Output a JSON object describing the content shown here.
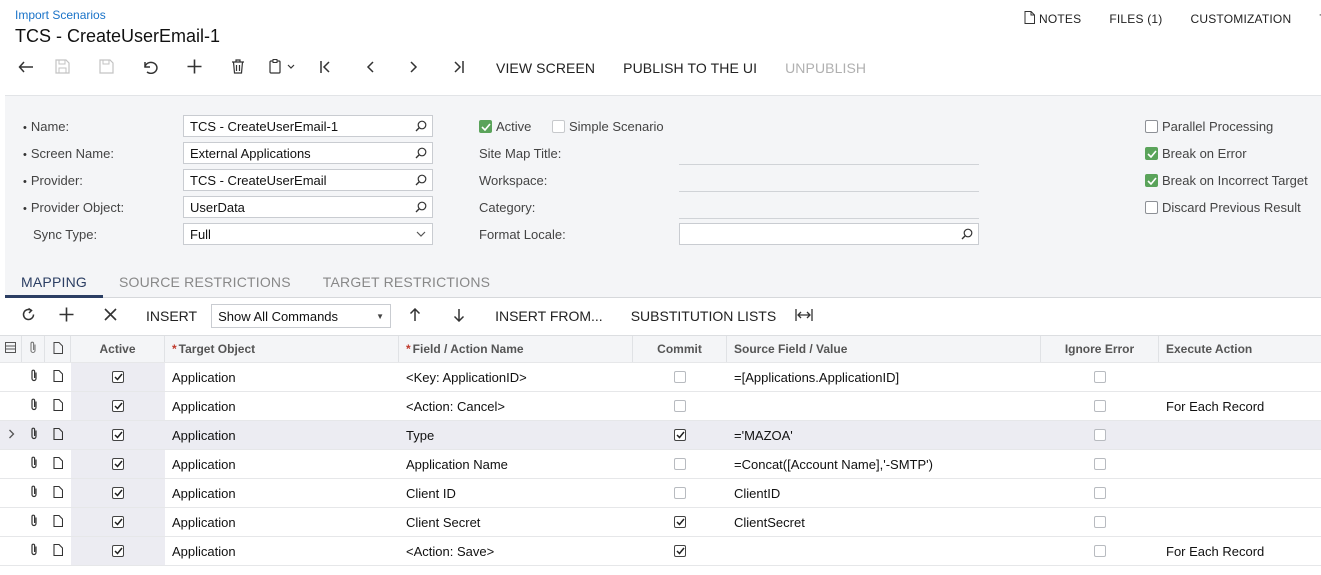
{
  "header": {
    "breadcrumb": "Import Scenarios",
    "title": "TCS - CreateUserEmail-1",
    "links": {
      "notes": "NOTES",
      "files": "FILES (1)",
      "customization": "CUSTOMIZATION",
      "overflow": "T"
    }
  },
  "toolbar": {
    "view_screen": "VIEW SCREEN",
    "publish": "PUBLISH TO THE UI",
    "unpublish": "UNPUBLISH"
  },
  "form": {
    "name_label": "Name:",
    "name_value": "TCS - CreateUserEmail-1",
    "screen_name_label": "Screen Name:",
    "screen_name_value": "External Applications",
    "provider_label": "Provider:",
    "provider_value": "TCS - CreateUserEmail",
    "provider_object_label": "Provider Object:",
    "provider_object_value": "UserData",
    "sync_type_label": "Sync Type:",
    "sync_type_value": "Full",
    "active_label": "Active",
    "active_checked": true,
    "simple_label": "Simple Scenario",
    "simple_checked": false,
    "site_map_label": "Site Map Title:",
    "site_map_value": "",
    "workspace_label": "Workspace:",
    "workspace_value": "",
    "category_label": "Category:",
    "category_value": "",
    "format_locale_label": "Format Locale:",
    "format_locale_value": "",
    "parallel_label": "Parallel Processing",
    "parallel_checked": false,
    "break_error_label": "Break on Error",
    "break_error_checked": true,
    "break_target_label": "Break on Incorrect Target",
    "break_target_checked": true,
    "discard_label": "Discard Previous Result",
    "discard_checked": false
  },
  "tabs": [
    {
      "label": "MAPPING",
      "active": true
    },
    {
      "label": "SOURCE RESTRICTIONS",
      "active": false
    },
    {
      "label": "TARGET RESTRICTIONS",
      "active": false
    }
  ],
  "grid_toolbar": {
    "insert": "INSERT",
    "command_filter": "Show All Commands",
    "insert_from": "INSERT FROM...",
    "substitution_lists": "SUBSTITUTION LISTS"
  },
  "grid": {
    "columns": {
      "active": "Active",
      "target_object": "Target Object",
      "field_action": "Field / Action Name",
      "commit": "Commit",
      "source": "Source Field / Value",
      "ignore_error": "Ignore Error",
      "execute_action": "Execute Action"
    },
    "rows": [
      {
        "active": true,
        "target": "Application",
        "field": "<Key: ApplicationID>",
        "commit": false,
        "source": "=[Applications.ApplicationID]",
        "ignore": false,
        "execute": "",
        "selected": false
      },
      {
        "active": true,
        "target": "Application",
        "field": "<Action: Cancel>",
        "commit": false,
        "source": "",
        "ignore": false,
        "execute": "For Each Record",
        "selected": false
      },
      {
        "active": true,
        "target": "Application",
        "field": "Type",
        "commit": true,
        "source": "='MAZOA'",
        "ignore": false,
        "execute": "",
        "selected": true
      },
      {
        "active": true,
        "target": "Application",
        "field": "Application Name",
        "commit": false,
        "source": "=Concat([Account Name],'-SMTP')",
        "ignore": false,
        "execute": "",
        "selected": false
      },
      {
        "active": true,
        "target": "Application",
        "field": "Client ID",
        "commit": false,
        "source": "ClientID",
        "ignore": false,
        "execute": "",
        "selected": false
      },
      {
        "active": true,
        "target": "Application",
        "field": "Client Secret",
        "commit": true,
        "source": "ClientSecret",
        "ignore": false,
        "execute": "",
        "selected": false
      },
      {
        "active": true,
        "target": "Application",
        "field": "<Action: Save>",
        "commit": true,
        "source": "",
        "ignore": false,
        "execute": "For Each Record",
        "selected": false
      }
    ]
  }
}
